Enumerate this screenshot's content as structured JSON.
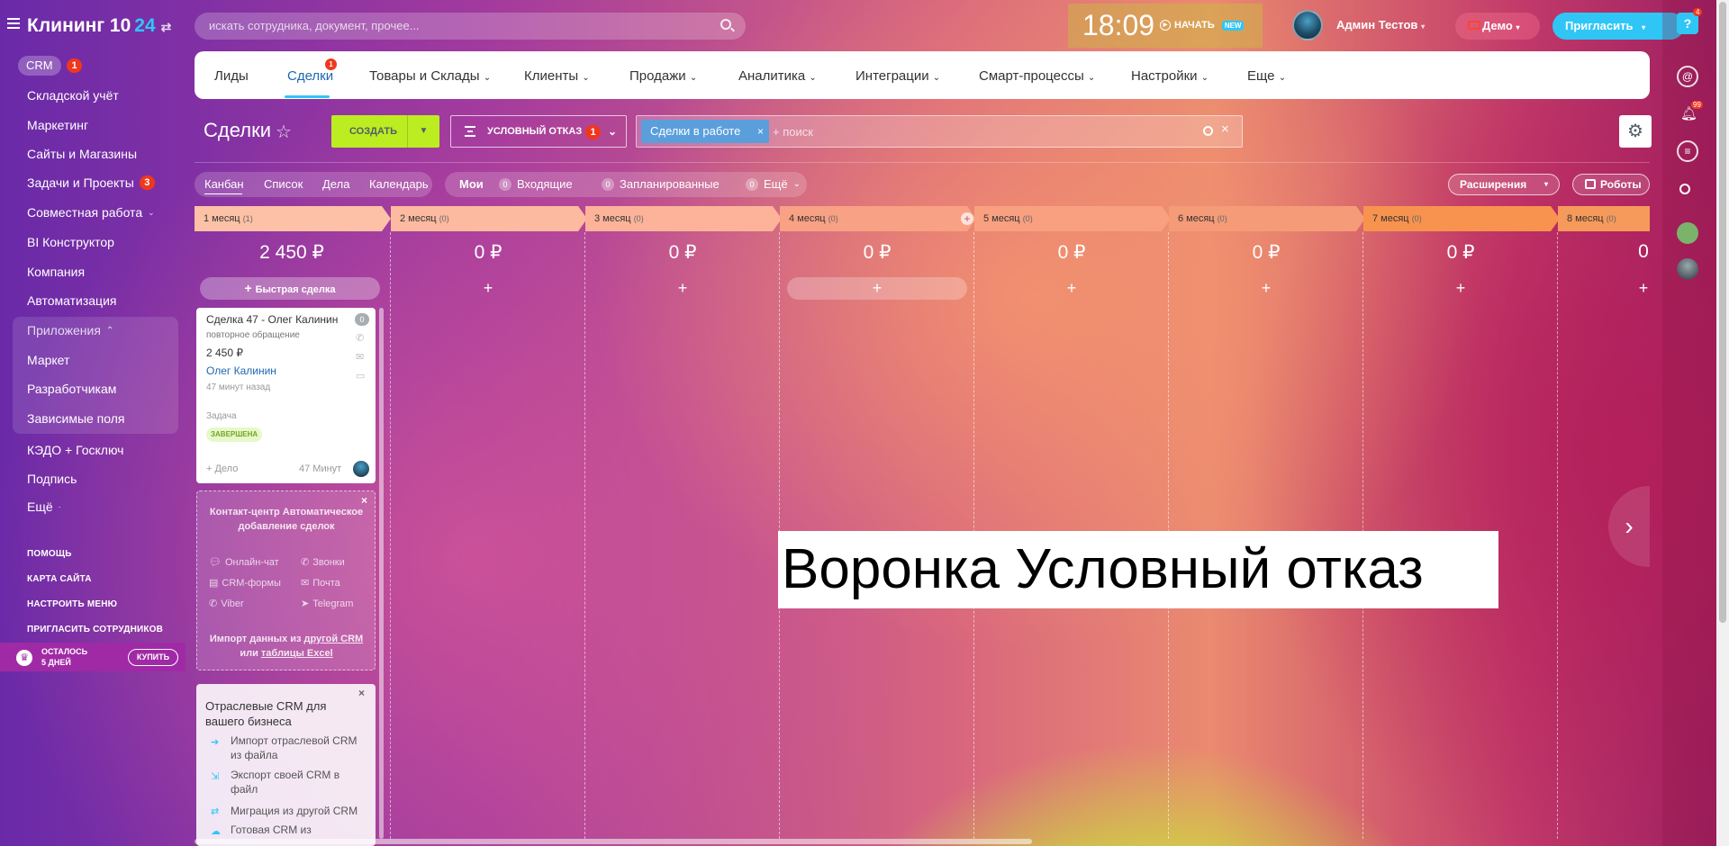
{
  "sidebar": {
    "logo_main": "Клининг 10",
    "logo_24": "24",
    "crm_label": "CRM",
    "crm_badge": "1",
    "items": [
      "Складской учёт",
      "Маркетинг",
      "Сайты и Магазины",
      "Задачи и Проекты",
      "Совместная работа",
      "BI Конструктор",
      "Компания",
      "Автоматизация",
      "Приложения",
      "Маркет",
      "Разработчикам",
      "Зависимые поля",
      "КЭДО + Госключ",
      "Подпись",
      "Ещё"
    ],
    "tasks_badge": "3",
    "links": [
      "ПОМОЩЬ",
      "КАРТА САЙТА",
      "НАСТРОИТЬ МЕНЮ",
      "ПРИГЛАСИТЬ СОТРУДНИКОВ"
    ],
    "trial_line1": "ОСТАЛОСЬ",
    "trial_line2": "5 ДНЕЙ",
    "buy": "КУПИТЬ"
  },
  "topbar": {
    "search_placeholder": "искать сотрудника, документ, прочее...",
    "clock": "18:09",
    "start": "НАЧАТЬ",
    "new": "NEW",
    "user": "Админ Тестов",
    "demo": "Демо",
    "invite": "Пригласить",
    "help_badge": "4",
    "bell_badge": "99"
  },
  "nav": {
    "items": [
      "Лиды",
      "Сделки",
      "Товары и Склады",
      "Клиенты",
      "Продажи",
      "Аналитика",
      "Интеграции",
      "Смарт-процессы",
      "Настройки",
      "Еще"
    ],
    "deals_badge": "1"
  },
  "toolbar": {
    "title": "Сделки",
    "create": "СОЗДАТЬ",
    "funnel": "УСЛОВНЫЙ ОТКАЗ",
    "funnel_badge": "1",
    "filter_chip": "Сделки в работе",
    "filter_placeholder": "+ поиск"
  },
  "views": {
    "items": [
      "Канбан",
      "Список",
      "Дела",
      "Календарь"
    ],
    "mine": "Мои",
    "counters": [
      {
        "count": "0",
        "label": "Входящие"
      },
      {
        "count": "0",
        "label": "Запланированные"
      },
      {
        "count": "0",
        "label": "Ещё"
      }
    ],
    "extensions": "Расширения",
    "robots": "Роботы"
  },
  "stages": [
    {
      "name": "1 месяц",
      "count": "(1)",
      "sum": "2 450 ₽",
      "color": "#fcc1a6"
    },
    {
      "name": "2 месяц",
      "count": "(0)",
      "sum": "0 ₽",
      "color": "#fcbaa0"
    },
    {
      "name": "3 месяц",
      "count": "(0)",
      "sum": "0 ₽",
      "color": "#fcb39a"
    },
    {
      "name": "4 месяц",
      "count": "(0)",
      "sum": "0 ₽",
      "color": "#f8a184"
    },
    {
      "name": "5 месяц",
      "count": "(0)",
      "sum": "0 ₽",
      "color": "#f8a080"
    },
    {
      "name": "6 месяц",
      "count": "(0)",
      "sum": "0 ₽",
      "color": "#f59b78"
    },
    {
      "name": "7 месяц",
      "count": "(0)",
      "sum": "0 ₽",
      "color": "#f7934f"
    },
    {
      "name": "8 месяц",
      "count": "(0)",
      "sum": "0",
      "color": "#f69a5b"
    }
  ],
  "quick_deal": "Быстрая сделка",
  "deal_card": {
    "title": "Сделка 47 - Олег Калинин",
    "subtitle": "повторное обращение",
    "price": "2 450 ₽",
    "client": "Олег Калинин",
    "time": "47 минут назад",
    "task_label": "Задача",
    "status": "ЗАВЕРШЕНА",
    "add": "+ Дело",
    "ago": "47 Минут",
    "counter": "0"
  },
  "promo_contact": {
    "title": "Контакт-центр Автоматическое добавление сделок",
    "channels": [
      "Онлайн-чат",
      "Звонки",
      "CRM-формы",
      "Почта",
      "Viber",
      "Telegram"
    ],
    "import_pre": "Импорт данных из ",
    "import_link1": "другой CRM",
    "import_mid": " или ",
    "import_link2": "таблицы Excel"
  },
  "promo_industry": {
    "title": "Отраслевые CRM для вашего бизнеса",
    "items": [
      "Импорт отраслевой CRM из файла",
      "Экспорт своей CRM в файл",
      "Миграция из другой CRM",
      "Готовая CRM из"
    ]
  },
  "overlay": "Воронка Условный отказ"
}
